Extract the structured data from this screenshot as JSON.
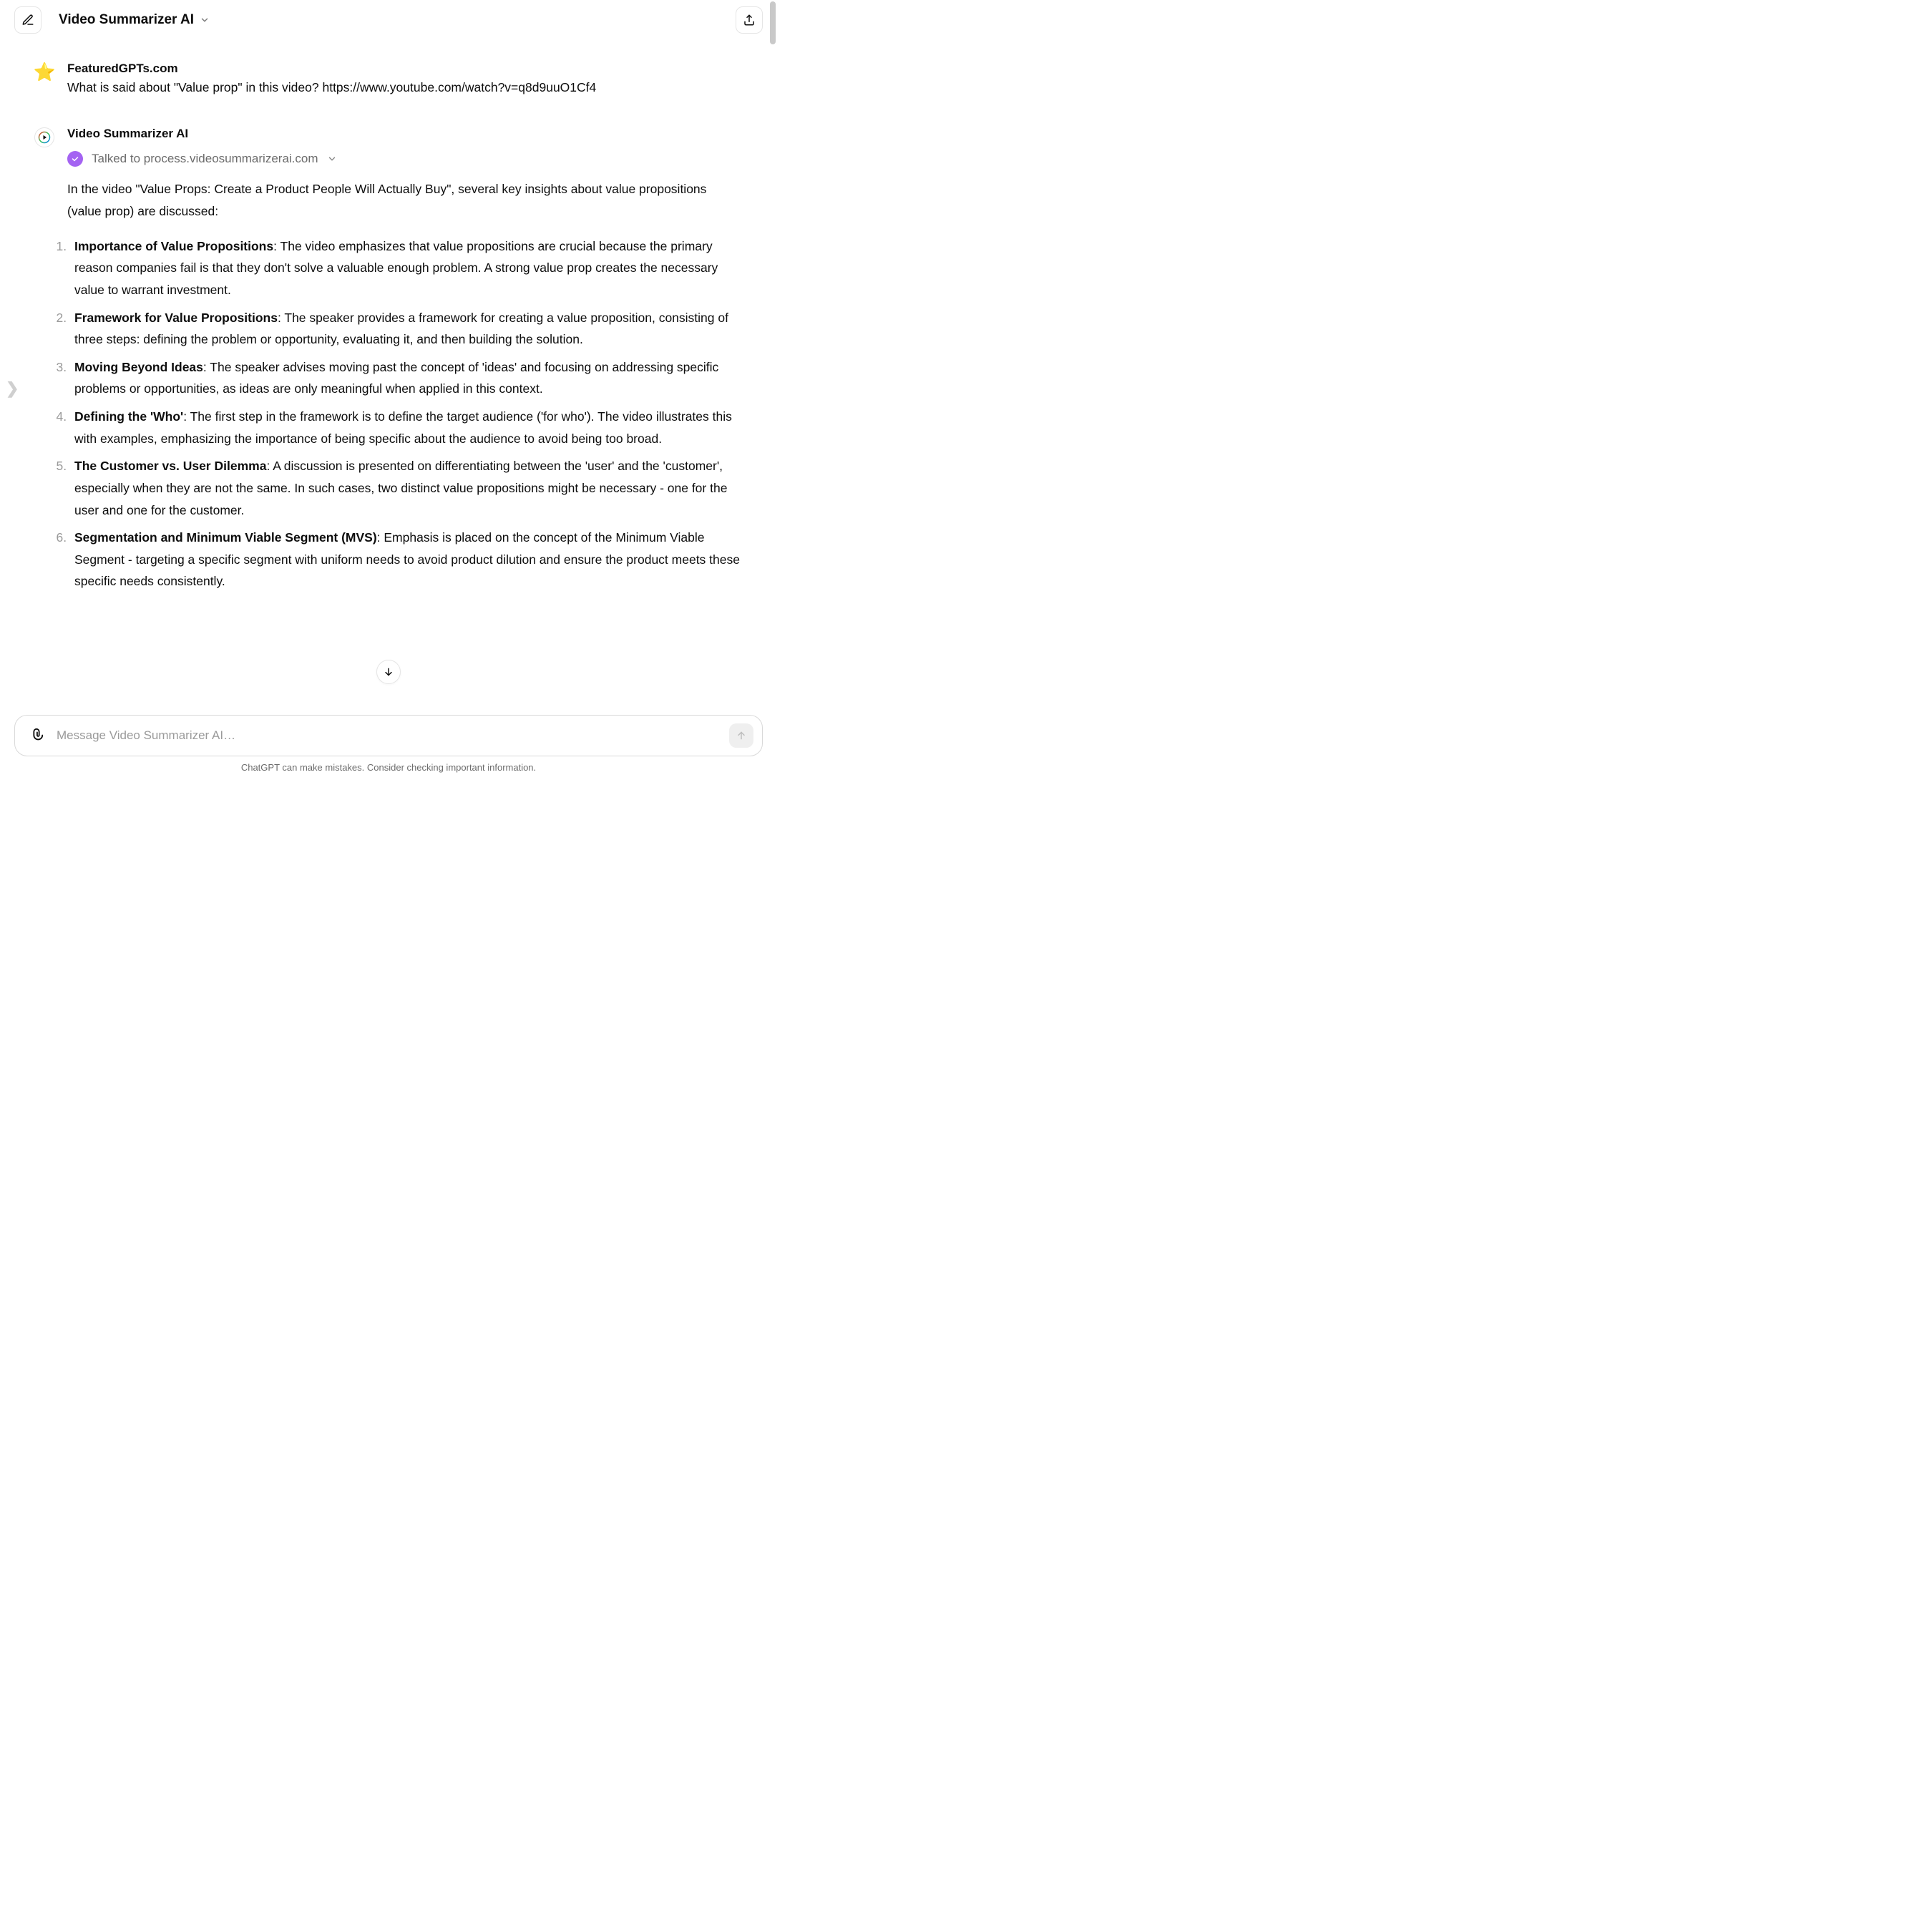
{
  "header": {
    "title": "Video Summarizer AI"
  },
  "side_hint_glyph": "❯",
  "user_msg": {
    "author": "FeaturedGPTs.com",
    "text": "What is said about \"Value prop\" in this video? https://www.youtube.com/watch?v=q8d9uuO1Cf4",
    "avatar_glyph": "⭐"
  },
  "ai_msg": {
    "author": "Video Summarizer AI",
    "tool_call": "Talked to process.videosummarizerai.com",
    "intro": "In the video \"Value Props: Create a Product People Will Actually Buy\", several key insights about value propositions (value prop) are discussed:",
    "points": [
      {
        "title": "Importance of Value Propositions",
        "body": ": The video emphasizes that value propositions are crucial because the primary reason companies fail is that they don't solve a valuable enough problem. A strong value prop creates the necessary value to warrant investment."
      },
      {
        "title": "Framework for Value Propositions",
        "body": ": The speaker provides a framework for creating a value proposition, consisting of three steps: defining the problem or opportunity, evaluating it, and then building the solution."
      },
      {
        "title": "Moving Beyond Ideas",
        "body": ": The speaker advises moving past the concept of 'ideas' and focusing on addressing specific problems or opportunities, as ideas are only meaningful when applied in this context."
      },
      {
        "title": "Defining the 'Who'",
        "body": ": The first step in the framework is to define the target audience ('for who'). The video illustrates this with examples, emphasizing the importance of being specific about the audience to avoid being too broad."
      },
      {
        "title": "The Customer vs. User Dilemma",
        "body": ": A discussion is presented on differentiating between the 'user' and the 'customer', especially when they are not the same. In such cases, two distinct value propositions might be necessary - one for the user and one for the customer."
      },
      {
        "title": "Segmentation and Minimum Viable Segment (MVS)",
        "body": ": Emphasis is placed on the concept of the Minimum Viable Segment - targeting a specific segment with uniform needs to avoid product dilution and ensure the product meets these specific needs consistently."
      }
    ]
  },
  "composer": {
    "placeholder": "Message Video Summarizer AI…"
  },
  "disclaimer": "ChatGPT can make mistakes. Consider checking important information."
}
